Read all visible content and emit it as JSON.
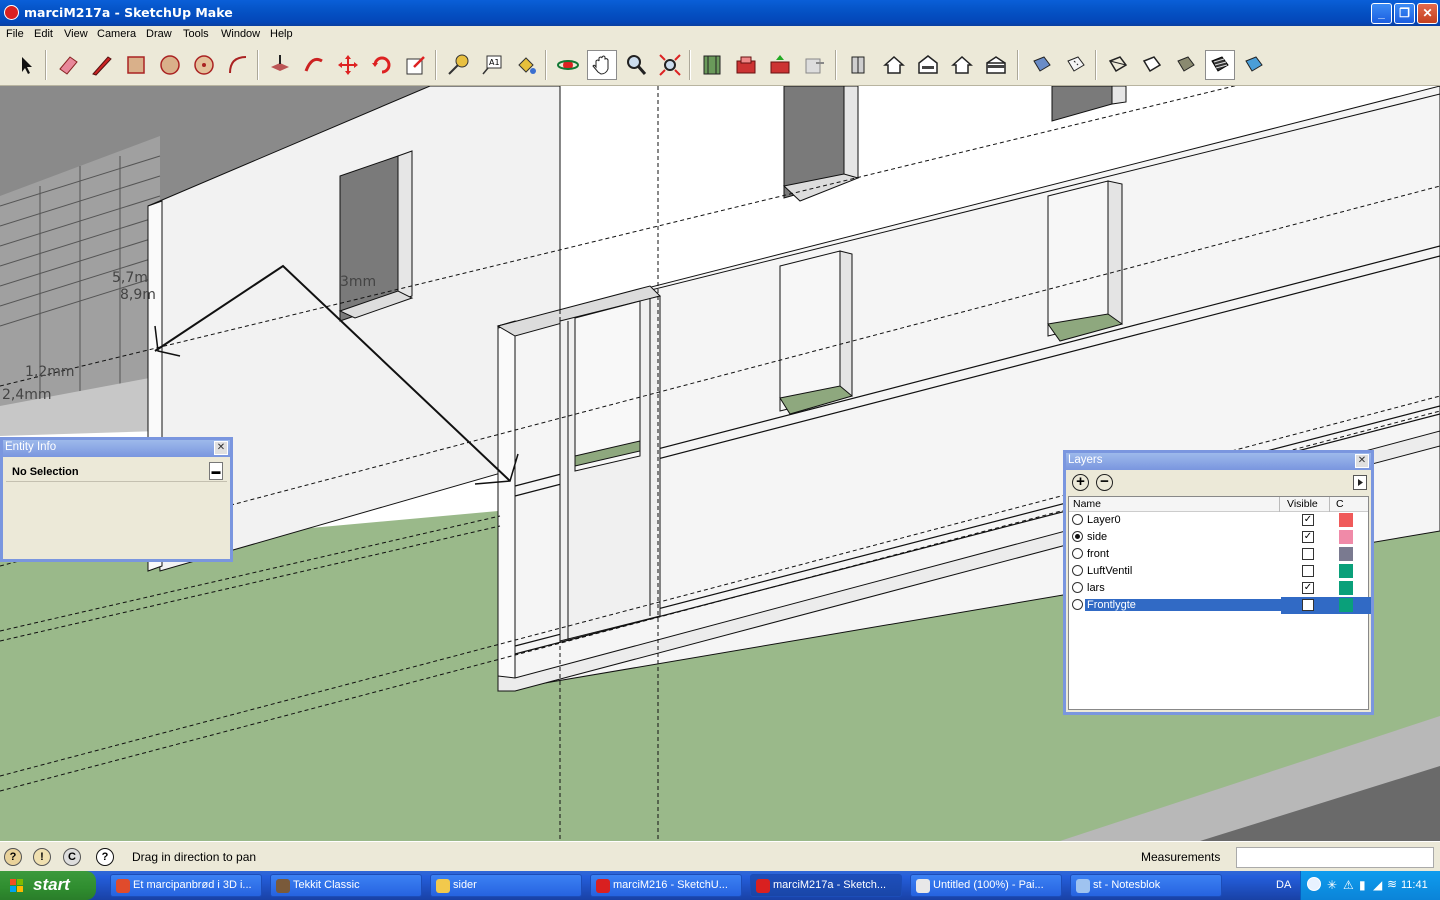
{
  "window": {
    "title": "marciM217a - SketchUp Make"
  },
  "menu": [
    "File",
    "Edit",
    "View",
    "Camera",
    "Draw",
    "Tools",
    "Window",
    "Help"
  ],
  "toolbar_icons": [
    "select-icon",
    "eraser-icon",
    "pencil-icon",
    "rectangle-icon",
    "circle-icon",
    "polygon-icon",
    "arc-icon",
    "push-pull-icon",
    "follow-me-icon",
    "move-icon",
    "rotate-icon",
    "scale-icon",
    "tape-measure-icon",
    "text-icon",
    "paint-bucket-icon",
    "orbit-icon",
    "pan-icon",
    "zoom-icon",
    "zoom-extents-icon",
    "add-location-icon",
    "get-models-icon",
    "share-model-icon",
    "share-component-icon",
    "send-to-layout-icon",
    "iso-view-icon",
    "top-view-icon",
    "front-view-icon",
    "right-view-icon",
    "back-view-icon",
    "left-view-icon",
    "xray-icon",
    "back-edges-icon",
    "wireframe-icon",
    "hidden-line-icon",
    "shaded-icon",
    "shaded-textures-icon",
    "monochrome-icon"
  ],
  "viewport": {
    "dimension_labels": [
      "5,7m",
      "8,9m",
      "3mm",
      "1,2mm",
      "2,4mm"
    ]
  },
  "entity_info": {
    "title": "Entity Info",
    "selection": "No Selection"
  },
  "layers": {
    "title": "Layers",
    "col_name": "Name",
    "col_visible": "Visible",
    "col_color": "C",
    "rows": [
      {
        "name": "Layer0",
        "active": false,
        "visible": true,
        "color": "#f05a5a"
      },
      {
        "name": "side",
        "active": true,
        "visible": true,
        "color": "#f08aa8"
      },
      {
        "name": "front",
        "active": false,
        "visible": false,
        "color": "#7a7a90"
      },
      {
        "name": "LuftVentil",
        "active": false,
        "visible": false,
        "color": "#0aa07a"
      },
      {
        "name": "lars",
        "active": false,
        "visible": true,
        "color": "#0aa07a"
      },
      {
        "name": "Frontlygte",
        "active": false,
        "visible": false,
        "color": "#0aa07a",
        "selected": true
      }
    ]
  },
  "status": {
    "hint": "Drag in direction to pan",
    "measurements_label": "Measurements",
    "measurements_value": ""
  },
  "taskbar": {
    "start": "start",
    "tasks": [
      {
        "label": "Et marcipanbrød i 3D i...",
        "icon_color": "#e04b2c"
      },
      {
        "label": "Tekkit Classic",
        "icon_color": "#7a5a3a"
      },
      {
        "label": "sider",
        "icon_color": "#f2c94c"
      },
      {
        "label": "marciM216 - SketchU...",
        "icon_color": "#d92020"
      },
      {
        "label": "marciM217a - Sketch...",
        "icon_color": "#d92020",
        "active": true
      },
      {
        "label": "Untitled (100%) - Pai...",
        "icon_color": "#e8e8e8"
      },
      {
        "label": "st - Notesblok",
        "icon_color": "#9fc3f0"
      }
    ],
    "lang": "DA",
    "clock": "11:41"
  }
}
